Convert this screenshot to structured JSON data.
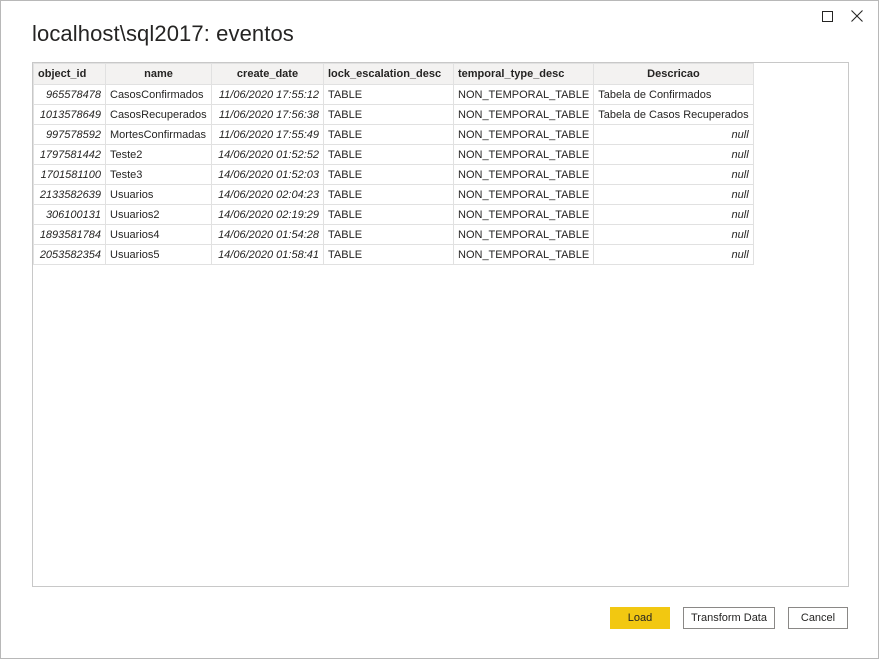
{
  "window": {
    "title": "localhost\\sql2017: eventos",
    "maximize_icon": "square-icon",
    "close_icon": "close-x-icon"
  },
  "table": {
    "columns": [
      "object_id",
      "name",
      "create_date",
      "lock_escalation_desc",
      "temporal_type_desc",
      "Descricao"
    ],
    "rows": [
      [
        "965578478",
        "CasosConfirmados",
        "11/06/2020 17:55:12",
        "TABLE",
        "NON_TEMPORAL_TABLE",
        "Tabela de Confirmados"
      ],
      [
        "1013578649",
        "CasosRecuperados",
        "11/06/2020 17:56:38",
        "TABLE",
        "NON_TEMPORAL_TABLE",
        "Tabela de Casos Recuperados"
      ],
      [
        "997578592",
        "MortesConfirmadas",
        "11/06/2020 17:55:49",
        "TABLE",
        "NON_TEMPORAL_TABLE",
        "null"
      ],
      [
        "1797581442",
        "Teste2",
        "14/06/2020 01:52:52",
        "TABLE",
        "NON_TEMPORAL_TABLE",
        "null"
      ],
      [
        "1701581100",
        "Teste3",
        "14/06/2020 01:52:03",
        "TABLE",
        "NON_TEMPORAL_TABLE",
        "null"
      ],
      [
        "2133582639",
        "Usuarios",
        "14/06/2020 02:04:23",
        "TABLE",
        "NON_TEMPORAL_TABLE",
        "null"
      ],
      [
        "306100131",
        "Usuarios2",
        "14/06/2020 02:19:29",
        "TABLE",
        "NON_TEMPORAL_TABLE",
        "null"
      ],
      [
        "1893581784",
        "Usuarios4",
        "14/06/2020 01:54:28",
        "TABLE",
        "NON_TEMPORAL_TABLE",
        "null"
      ],
      [
        "2053582354",
        "Usuarios5",
        "14/06/2020 01:58:41",
        "TABLE",
        "NON_TEMPORAL_TABLE",
        "null"
      ]
    ]
  },
  "footer": {
    "load_label": "Load",
    "transform_label": "Transform Data",
    "cancel_label": "Cancel"
  },
  "colors": {
    "primary_button": "#f2c811",
    "header_bg": "#f3f2f1",
    "grid_line": "#e1e1e1"
  }
}
